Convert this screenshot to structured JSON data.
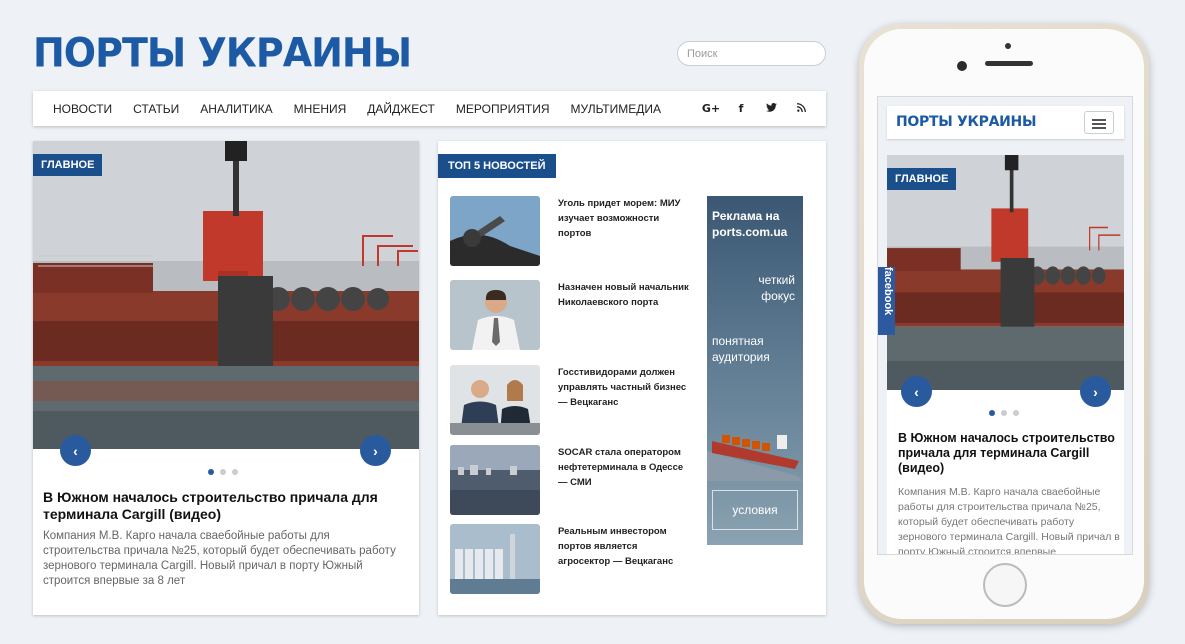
{
  "site": {
    "logo": "ПОРТЫ УКРАИНЫ",
    "search_placeholder": "Поиск"
  },
  "nav": {
    "items": [
      "НОВОСТИ",
      "СТАТЬИ",
      "АНАЛИТИКА",
      "МНЕНИЯ",
      "ДАЙДЖЕСТ",
      "МЕРОПРИЯТИЯ",
      "МУЛЬТИМЕДИА"
    ],
    "social": [
      "G+",
      "f",
      "t",
      "rss"
    ]
  },
  "main_story": {
    "badge": "ГЛАВНОЕ",
    "title": "В Южном началось строительство причала для терминала Cargill (видео)",
    "text": "Компания М.В. Карго начала сваебойные работы для строительства причала №25, который будет обеспечивать работу зернового терминала Cargill. Новый причал в порту Южный строится впервые за 8 лет",
    "slides": 3,
    "active_slide": 1
  },
  "top_news": {
    "badge": "ТОП 5 НОВОСТЕЙ",
    "items": [
      {
        "title": "Уголь придет морем: МИУ изучает возможности портов",
        "thumb": "coal"
      },
      {
        "title": "Назначен новый начальник Николаевского порта",
        "thumb": "man"
      },
      {
        "title": "Госстивидорами должен управлять частный бизнес — Вецкаганс",
        "thumb": "meeting"
      },
      {
        "title": "SOCAR стала оператором нефтетерминала в Одессе — СМИ",
        "thumb": "terminal"
      },
      {
        "title": "Реальным инвестором портов является агросектор — Вецкаганс",
        "thumb": "silos"
      }
    ]
  },
  "ad": {
    "title_line1": "Реклама на",
    "title_line2": "ports.com.ua",
    "tag1_line1": "четкий",
    "tag1_line2": "фокус",
    "tag2_line1": "понятная",
    "tag2_line2": "аудитория",
    "button": "условия"
  },
  "mobile": {
    "logo": "ПОРТЫ УКРАИНЫ",
    "badge": "ГЛАВНОЕ",
    "facebook_tab": "facebook",
    "title": "В Южном началось строительство причала для терминала Cargill (видео)",
    "text": "Компания М.В. Карго начала сваебойные работы для строительства причала №25, который будет обеспечивать работу зернового терминала Cargill. Новый причал в порту Южный строится впервые"
  },
  "colors": {
    "brand": "#1d5aa6",
    "badge": "#1a4f8c",
    "arrow": "#2a5a9e",
    "background": "#eef1f5"
  }
}
